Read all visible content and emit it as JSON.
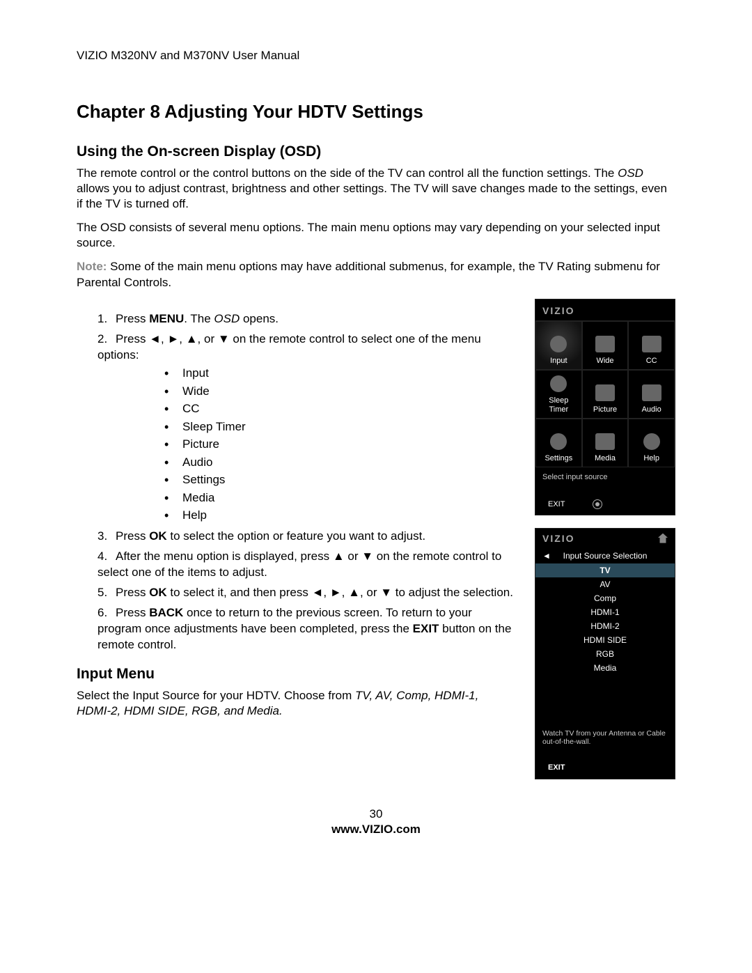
{
  "header": "VIZIO M320NV and M370NV User Manual",
  "chapter_title": "Chapter 8 Adjusting Your HDTV Settings",
  "section1_title": "Using the On-screen Display (OSD)",
  "p1": "The remote control or the control buttons on the side of the TV can control all the function settings. The ",
  "p1_italic": "OSD",
  "p1_rest": " allows you to adjust contrast, brightness and other settings. The TV will save changes made to the settings, even if the TV is turned off.",
  "p2": "The OSD consists of several menu options. The main menu options may vary depending on your selected input source.",
  "note_label": "Note:",
  "note_text": " Some of the main menu options may have additional submenus, for example, the TV Rating submenu for Parental Controls.",
  "step1_a": "Press ",
  "step1_b": "MENU",
  "step1_c": ". The ",
  "step1_d": "OSD",
  "step1_e": " opens.",
  "step2": "Press ◄, ►, ▲, or ▼ on the remote control to select one of the menu options:",
  "bullets": [
    "Input",
    "Wide",
    "CC",
    "Sleep Timer",
    "Picture",
    "Audio",
    "Settings",
    "Media",
    "Help"
  ],
  "step3_a": "Press ",
  "step3_b": "OK",
  "step3_c": " to select the option or feature you want to adjust.",
  "step4": "After the menu option is displayed, press ▲ or ▼ on the remote control to select one of the items to adjust.",
  "step5_a": "Press ",
  "step5_b": "OK",
  "step5_c": " to select it, and then press ◄, ►, ▲, or ▼ to adjust the selection.",
  "step6_a": "Press ",
  "step6_b": "BACK",
  "step6_c": " once to return to the previous screen. To return to your program once adjustments have been completed, press the ",
  "step6_d": "EXIT",
  "step6_e": " button on the remote control.",
  "section2_title": "Input Menu",
  "input_p_a": "Select the Input Source for your HDTV. Choose from ",
  "input_p_b": "TV, AV, Comp, HDMI-1, HDMI-2, HDMI SIDE, RGB, and Media.",
  "osd": {
    "logo": "VIZIO",
    "items": [
      {
        "label": "Input"
      },
      {
        "label": "Wide"
      },
      {
        "label": "CC"
      },
      {
        "label": "Sleep\nTimer"
      },
      {
        "label": "Picture"
      },
      {
        "label": "Audio"
      },
      {
        "label": "Settings"
      },
      {
        "label": "Media"
      },
      {
        "label": "Help"
      }
    ],
    "msg": "Select input source",
    "exit": "EXIT"
  },
  "inpanel": {
    "logo": "VIZIO",
    "arrow": "◄",
    "title": "Input Source Selection",
    "items": [
      "TV",
      "AV",
      "Comp",
      "HDMI-1",
      "HDMI-2",
      "HDMI SIDE",
      "RGB",
      "Media"
    ],
    "desc": "Watch TV from your Antenna or Cable out-of-the-wall.",
    "exit": "EXIT"
  },
  "footer": {
    "page": "30",
    "url": "www.VIZIO.com"
  }
}
